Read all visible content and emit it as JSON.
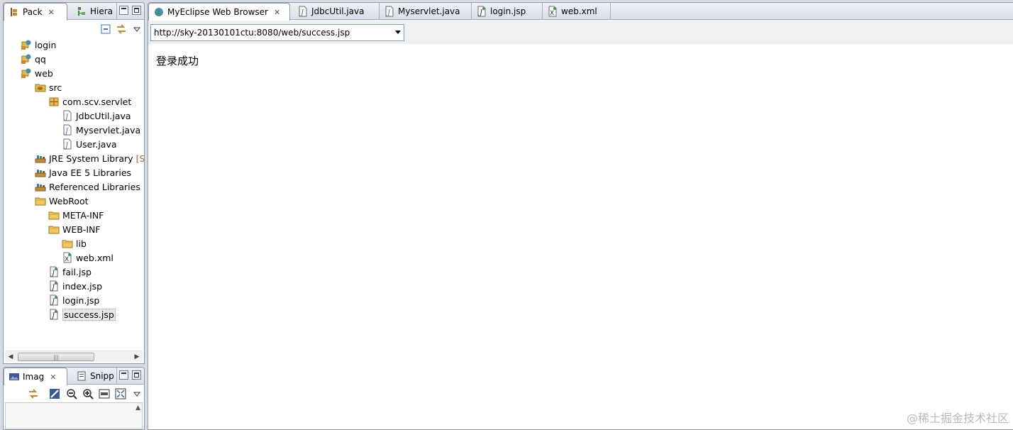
{
  "left_top_panel": {
    "tabs": [
      {
        "label": "Pack",
        "icon": "package-explorer-icon",
        "active": true
      },
      {
        "label": "Hiera",
        "icon": "hierarchy-icon",
        "active": false
      }
    ],
    "tree": [
      {
        "label": "login",
        "icon": "web-project-icon",
        "level": 0
      },
      {
        "label": "qq",
        "icon": "web-project-icon",
        "level": 0
      },
      {
        "label": "web",
        "icon": "web-project-icon",
        "level": 0
      },
      {
        "label": "src",
        "icon": "source-folder-icon",
        "level": 1
      },
      {
        "label": "com.scv.servlet",
        "icon": "package-icon",
        "level": 2
      },
      {
        "label": "JdbcUtil.java",
        "icon": "java-file-icon",
        "level": 3
      },
      {
        "label": "Myservlet.java",
        "icon": "java-file-icon",
        "level": 3
      },
      {
        "label": "User.java",
        "icon": "java-file-icon",
        "level": 3
      },
      {
        "label": "JRE System Library",
        "decor": "[Su",
        "icon": "library-icon",
        "level": 1
      },
      {
        "label": "Java EE 5 Libraries",
        "icon": "library-icon",
        "level": 1
      },
      {
        "label": "Referenced Libraries",
        "icon": "library-icon",
        "level": 1
      },
      {
        "label": "WebRoot",
        "icon": "folder-icon",
        "level": 1
      },
      {
        "label": "META-INF",
        "icon": "folder-icon",
        "level": 2
      },
      {
        "label": "WEB-INF",
        "icon": "folder-icon",
        "level": 2
      },
      {
        "label": "lib",
        "icon": "folder-icon",
        "level": 3
      },
      {
        "label": "web.xml",
        "icon": "xml-file-icon",
        "level": 3
      },
      {
        "label": "fail.jsp",
        "icon": "jsp-file-icon",
        "level": 2
      },
      {
        "label": "index.jsp",
        "icon": "jsp-file-icon",
        "level": 2
      },
      {
        "label": "login.jsp",
        "icon": "jsp-file-icon",
        "level": 2
      },
      {
        "label": "success.jsp",
        "icon": "jsp-file-icon",
        "level": 2,
        "selected": true
      }
    ],
    "scrollbar_grip": "|||"
  },
  "left_bottom_panel": {
    "tabs": [
      {
        "label": "Imag",
        "icon": "image-view-icon",
        "active": true
      },
      {
        "label": "Snipp",
        "icon": "snippets-icon",
        "active": false
      }
    ]
  },
  "editor": {
    "tabs": [
      {
        "label": "MyEclipse Web Browser",
        "icon": "globe-icon",
        "active": true
      },
      {
        "label": "JdbcUtil.java",
        "icon": "java-file-icon",
        "active": false
      },
      {
        "label": "Myservlet.java",
        "icon": "java-file-icon",
        "active": false
      },
      {
        "label": "login.jsp",
        "icon": "jsp-file-icon",
        "active": false
      },
      {
        "label": "web.xml",
        "icon": "xml-file-icon",
        "active": false
      }
    ],
    "address": "http://sky-20130101ctu:8080/web/success.jsp",
    "page_text": "登录成功"
  },
  "close_glyph": "✕",
  "watermark": "@稀土掘金技术社区",
  "colors": {
    "accent": "#7a9cc5",
    "folder": "#e8b84a",
    "java": "#4a6fb5",
    "library": "#c98a2a"
  }
}
